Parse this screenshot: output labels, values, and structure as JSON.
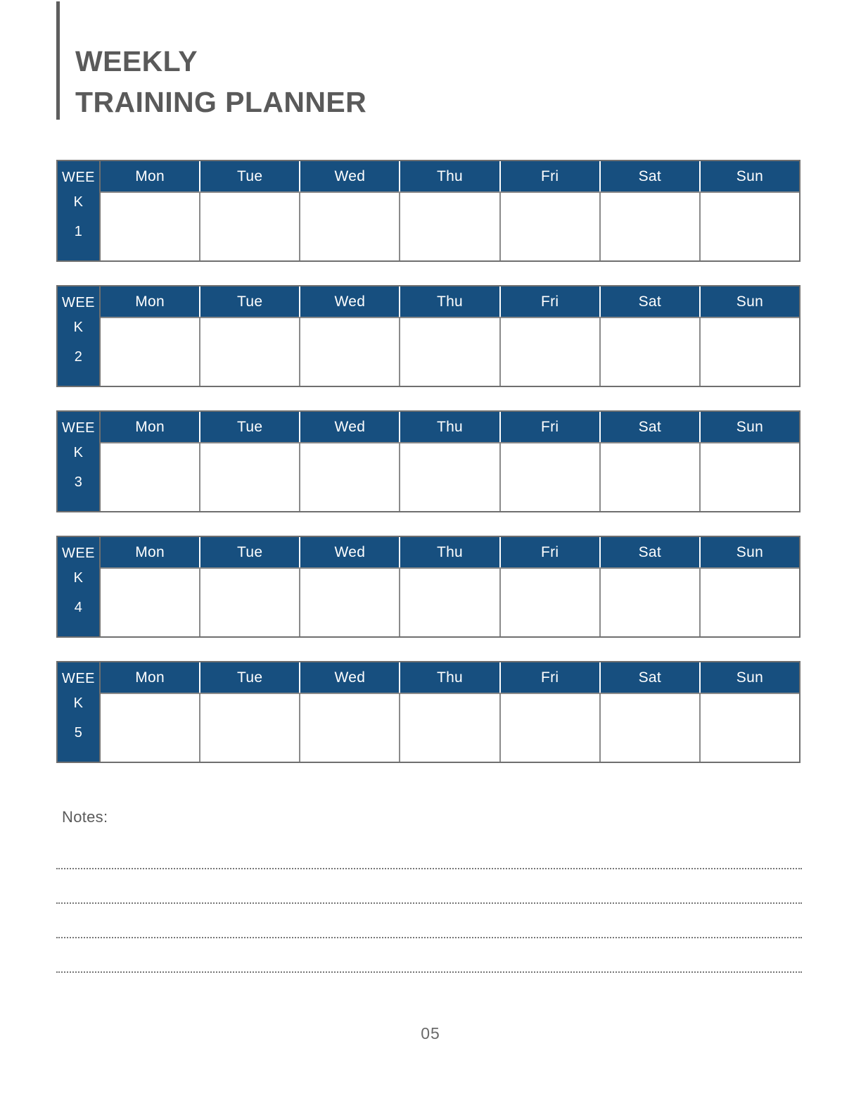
{
  "document": {
    "title_lines": [
      "WEEKLY",
      "TRAINING PLANNER"
    ],
    "page_number": "05"
  },
  "theme": {
    "accent_blue": "#174f7f",
    "title_gray": "#5a5a5a",
    "border_gray": "#6f6f6f",
    "cell_border_gray": "#8a8a8a",
    "header_text": "#ffffff"
  },
  "planner": {
    "day_headers": [
      "Mon",
      "Tue",
      "Wed",
      "Thu",
      "Fri",
      "Sat",
      "Sun"
    ],
    "weeks": [
      {
        "label": "WEEK",
        "number": "1",
        "cells": [
          "",
          "",
          "",
          "",
          "",
          "",
          ""
        ]
      },
      {
        "label": "WEEK",
        "number": "2",
        "cells": [
          "",
          "",
          "",
          "",
          "",
          "",
          ""
        ]
      },
      {
        "label": "WEEK",
        "number": "3",
        "cells": [
          "",
          "",
          "",
          "",
          "",
          "",
          ""
        ]
      },
      {
        "label": "WEEK",
        "number": "4",
        "cells": [
          "",
          "",
          "",
          "",
          "",
          "",
          ""
        ]
      },
      {
        "label": "WEEK",
        "number": "5",
        "cells": [
          "",
          "",
          "",
          "",
          "",
          "",
          ""
        ]
      }
    ]
  },
  "notes": {
    "label": "Notes:",
    "lines": [
      "",
      "",
      "",
      ""
    ]
  }
}
